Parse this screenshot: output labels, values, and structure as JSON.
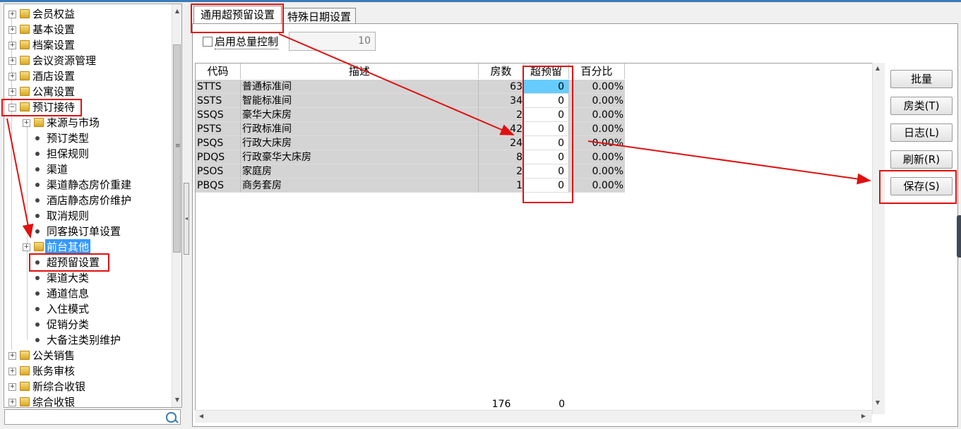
{
  "tree": {
    "items": [
      {
        "label": "会员权益"
      },
      {
        "label": "基本设置"
      },
      {
        "label": "档案设置"
      },
      {
        "label": "会议资源管理"
      },
      {
        "label": "酒店设置"
      },
      {
        "label": "公寓设置"
      },
      {
        "label": "预订接待"
      },
      {
        "label": "来源与市场"
      },
      {
        "label": "预订类型"
      },
      {
        "label": "担保规则"
      },
      {
        "label": "渠道"
      },
      {
        "label": "渠道静态房价重建"
      },
      {
        "label": "酒店静态房价维护"
      },
      {
        "label": "取消规则"
      },
      {
        "label": "同客换订单设置"
      },
      {
        "label": "前台其他"
      },
      {
        "label": "超预留设置"
      },
      {
        "label": "渠道大类"
      },
      {
        "label": "通道信息"
      },
      {
        "label": "入住模式"
      },
      {
        "label": "促销分类"
      },
      {
        "label": "大备注类别维护"
      },
      {
        "label": "公关销售"
      },
      {
        "label": "账务审核"
      },
      {
        "label": "新综合收银"
      },
      {
        "label": "综合收银"
      }
    ]
  },
  "tabs": [
    {
      "label": "通用超预留设置"
    },
    {
      "label": "特殊日期设置"
    }
  ],
  "control": {
    "checkbox_label": "启用总量控制",
    "total_value": "10"
  },
  "grid": {
    "headers": {
      "code": "代码",
      "desc": "描述",
      "rooms": "房数",
      "over": "超预留",
      "pct": "百分比"
    },
    "rows": [
      {
        "code": "STTS",
        "desc": "普通标准间",
        "rooms": "63",
        "over": "0",
        "pct": "0.00%"
      },
      {
        "code": "SSTS",
        "desc": "智能标准间",
        "rooms": "34",
        "over": "0",
        "pct": "0.00%"
      },
      {
        "code": "SSQS",
        "desc": "豪华大床房",
        "rooms": "2",
        "over": "0",
        "pct": "0.00%"
      },
      {
        "code": "PSTS",
        "desc": "行政标准间",
        "rooms": "42",
        "over": "0",
        "pct": "0.00%"
      },
      {
        "code": "PSQS",
        "desc": "行政大床房",
        "rooms": "24",
        "over": "0",
        "pct": "0.00%"
      },
      {
        "code": "PDQS",
        "desc": "行政豪华大床房",
        "rooms": "8",
        "over": "0",
        "pct": "0.00%"
      },
      {
        "code": "PSOS",
        "desc": "家庭房",
        "rooms": "2",
        "over": "0",
        "pct": "0.00%"
      },
      {
        "code": "PBQS",
        "desc": "商务套房",
        "rooms": "1",
        "over": "0",
        "pct": "0.00%"
      }
    ],
    "footer": {
      "rooms_total": "176",
      "over_total": "0"
    }
  },
  "buttons": {
    "batch": "批量",
    "room_type": "房类(T)",
    "log": "日志(L)",
    "refresh": "刷新(R)",
    "save": "保存(S)"
  },
  "colors": {
    "annotation": "#e01010",
    "selection": "#3399ff",
    "cell_highlight": "#66ccff"
  }
}
